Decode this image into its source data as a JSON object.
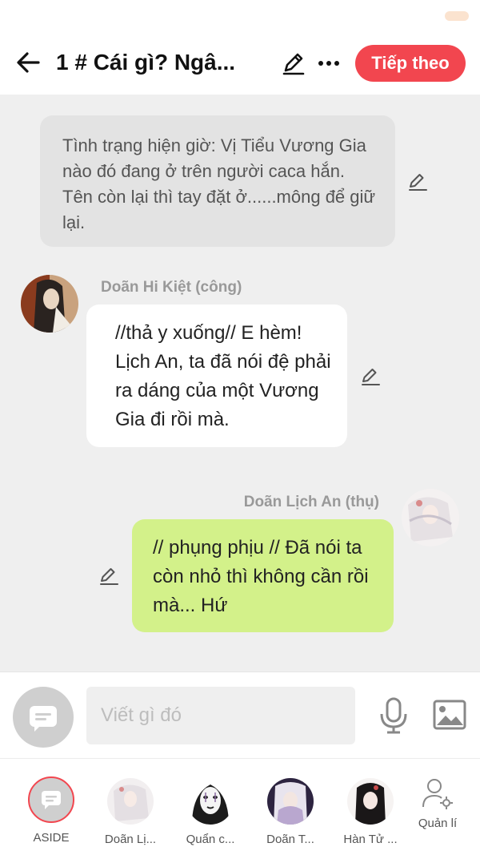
{
  "header": {
    "title": "1 # Cái gì? Ngâ...",
    "next_label": "Tiếp theo"
  },
  "chat": {
    "narration": "Tình trạng hiện giờ: Vị Tiểu Vương Gia nào đó đang ở trên người caca hắn. Tên còn lại thì tay đặt ở......mông để giữ lại.",
    "messages": [
      {
        "sender": "Doãn Hi Kiệt (công)",
        "text": "//thả y xuống// E hèm! Lịch An, ta đã nói đệ phải ra dáng của một Vương Gia đi rồi mà.",
        "side": "left"
      },
      {
        "sender": "Doãn Lịch An (thụ)",
        "text": "// phụng phịu // Đã nói ta còn nhỏ thì không cần rồi mà... Hứ",
        "side": "right"
      }
    ]
  },
  "composer": {
    "placeholder": "Viết gì đó"
  },
  "characters": [
    {
      "label": "ASIDE"
    },
    {
      "label": "Doãn Lị..."
    },
    {
      "label": "Quẩn c..."
    },
    {
      "label": "Doãn T..."
    },
    {
      "label": "Hàn Tử ..."
    },
    {
      "label": "Quản lí"
    }
  ],
  "colors": {
    "accent": "#f2464f",
    "narration_bg": "#e3e3e3",
    "right_bubble": "#d3f18a",
    "chat_bg": "#efefef"
  }
}
